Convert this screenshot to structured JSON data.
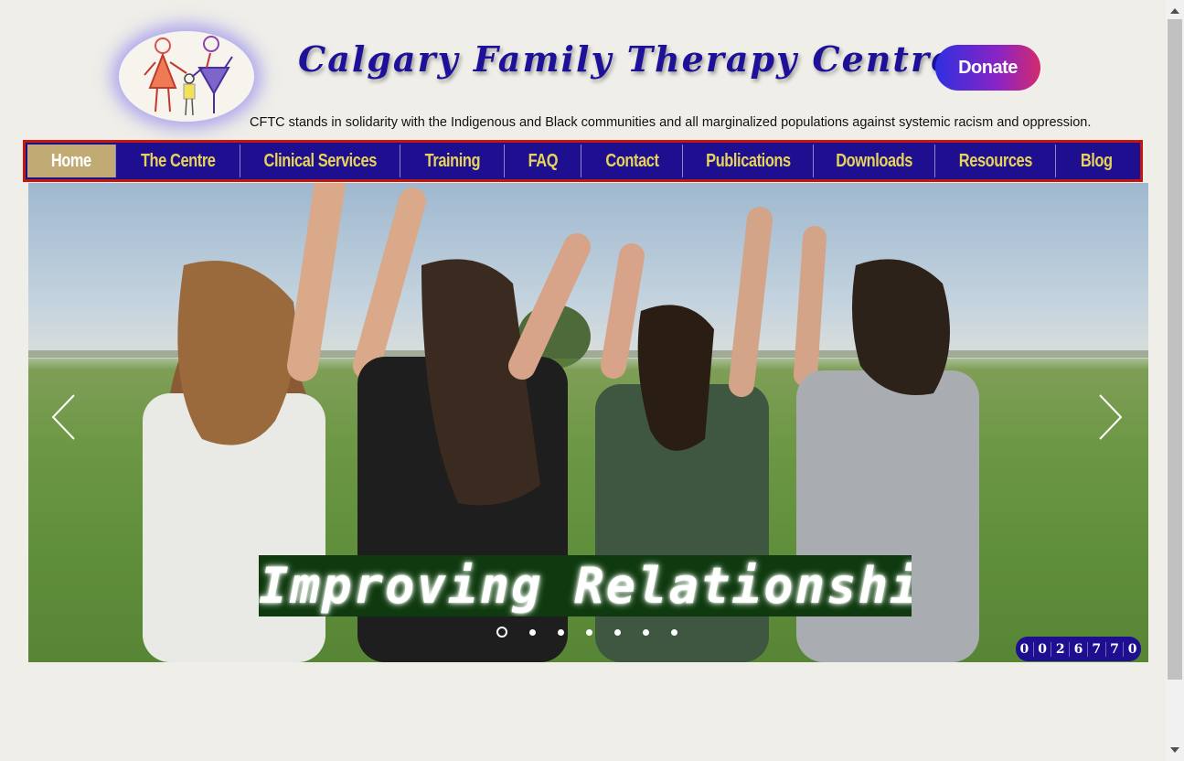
{
  "header": {
    "title": "Calgary Family Therapy Centre",
    "donate_label": "Donate",
    "tagline": "CFTC stands in solidarity with the Indigenous and Black communities and all marginalized populations against systemic racism and oppression."
  },
  "nav": {
    "items": [
      {
        "label": "Home",
        "active": true
      },
      {
        "label": "The Centre"
      },
      {
        "label": "Clinical Services"
      },
      {
        "label": "Training"
      },
      {
        "label": "FAQ"
      },
      {
        "label": "Contact"
      },
      {
        "label": "Publications"
      },
      {
        "label": "Downloads"
      },
      {
        "label": "Resources"
      },
      {
        "label": "Blog"
      }
    ]
  },
  "hero": {
    "caption": "Improving Relationships",
    "slide_count": 7,
    "active_slide": 1
  },
  "visitor_counter": {
    "digits": [
      "0",
      "0",
      "2",
      "6",
      "7",
      "7",
      "0"
    ]
  },
  "colors": {
    "nav_bg": "#1e0f90",
    "nav_text": "#e8d35a",
    "nav_active_bg": "#c2aa74",
    "nav_border": "#c1190e",
    "title_color": "#1e1199",
    "caption_bg": "#0f3a0f"
  },
  "icons": {
    "prev": "chevron-left-icon",
    "next": "chevron-right-icon",
    "logo": "family-figures-logo"
  }
}
